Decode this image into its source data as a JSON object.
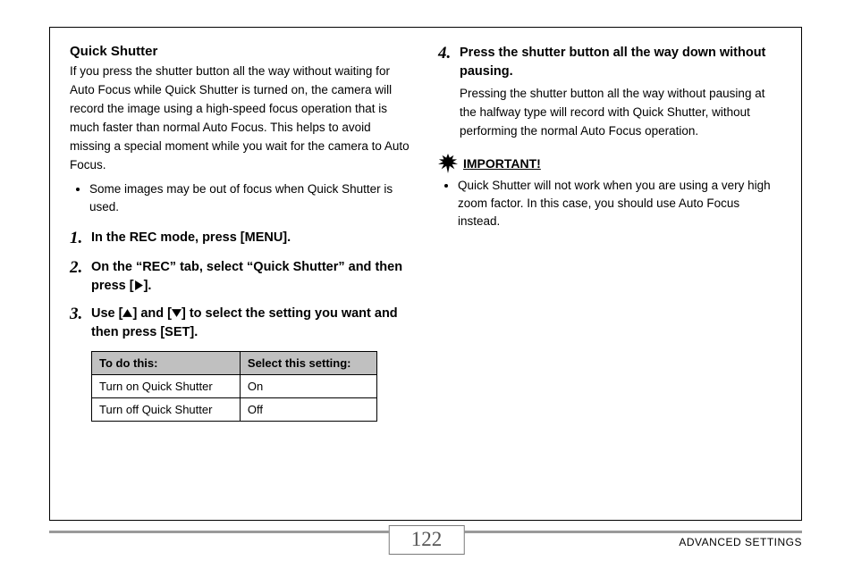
{
  "left": {
    "title": "Quick Shutter",
    "intro": "If you press the shutter button all the way without waiting for Auto Focus while Quick Shutter is turned on, the camera will record the image using a high-speed focus operation that is much faster than normal Auto Focus. This helps to avoid missing a special moment while you wait for the camera to Auto Focus.",
    "bullet1": "Some images may be out of focus when Quick Shutter is used.",
    "step1": "In the REC mode, press [MENU].",
    "step2_a": "On the “REC” tab, select “Quick Shutter” and then press [",
    "step2_b": "].",
    "step3_a": "Use [",
    "step3_b": "] and [",
    "step3_c": "] to select the setting you want and then press [SET].",
    "table": {
      "h1": "To do this:",
      "h2": "Select this setting:",
      "r1c1": "Turn on Quick Shutter",
      "r1c2": "On",
      "r2c1": "Turn off Quick Shutter",
      "r2c2": "Off"
    }
  },
  "right": {
    "step4": "Press the shutter button all the way down without pausing.",
    "step4_sub": "Pressing the shutter button all the way without pausing at the halfway type will record with Quick Shutter, without performing the normal Auto Focus operation.",
    "important_label": "IMPORTANT!",
    "important_bullet": "Quick Shutter will not work when you are using a very high zoom factor. In this case, you should use Auto Focus instead."
  },
  "footer": {
    "page": "122",
    "section": "ADVANCED SETTINGS"
  }
}
